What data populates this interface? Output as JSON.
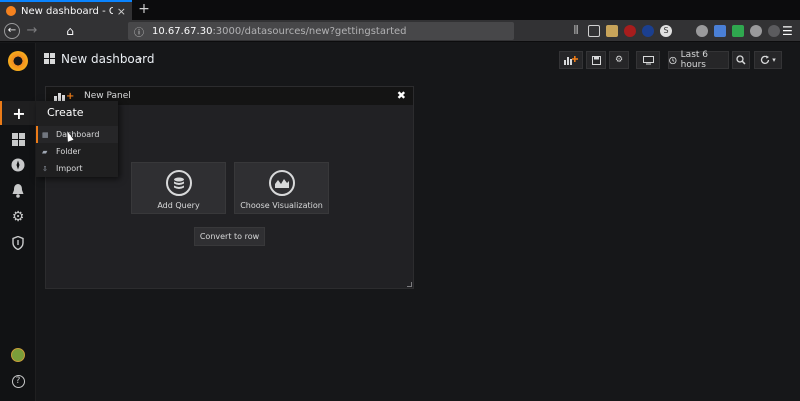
{
  "browser": {
    "tab_title": "New dashboard - Grafana",
    "tab_close": "×",
    "new_tab": "+",
    "url_host": "10.67.67.30",
    "url_path": ":3000/datasources/new?gettingstarted",
    "back": "←",
    "forward": "→",
    "home": "⌂",
    "menu": "☰"
  },
  "sidebar": {
    "create_icon": "+",
    "help": "?"
  },
  "create_menu": {
    "title": "Create",
    "items": [
      {
        "label": "Dashboard",
        "icon": "dashboard-icon"
      },
      {
        "label": "Folder",
        "icon": "folder-icon"
      },
      {
        "label": "Import",
        "icon": "import-icon"
      }
    ]
  },
  "dashboard": {
    "title": "New dashboard",
    "caret": "▾",
    "time_range": "Last 6 hours",
    "toolbar_icons": [
      "add-panel-icon",
      "save-icon",
      "gear-icon",
      "tv-icon",
      "clock-icon",
      "zoom-out-icon",
      "refresh-icon"
    ]
  },
  "panel": {
    "title": "New Panel",
    "close": "✖",
    "add_query_label": "Add Query",
    "choose_visualization_label": "Choose Visualization",
    "convert_to_row_label": "Convert to row"
  },
  "colors": {
    "accent": "#eb7b18",
    "background": "#161719",
    "panel": "#212124",
    "browser_accent": "#0a84ff"
  }
}
